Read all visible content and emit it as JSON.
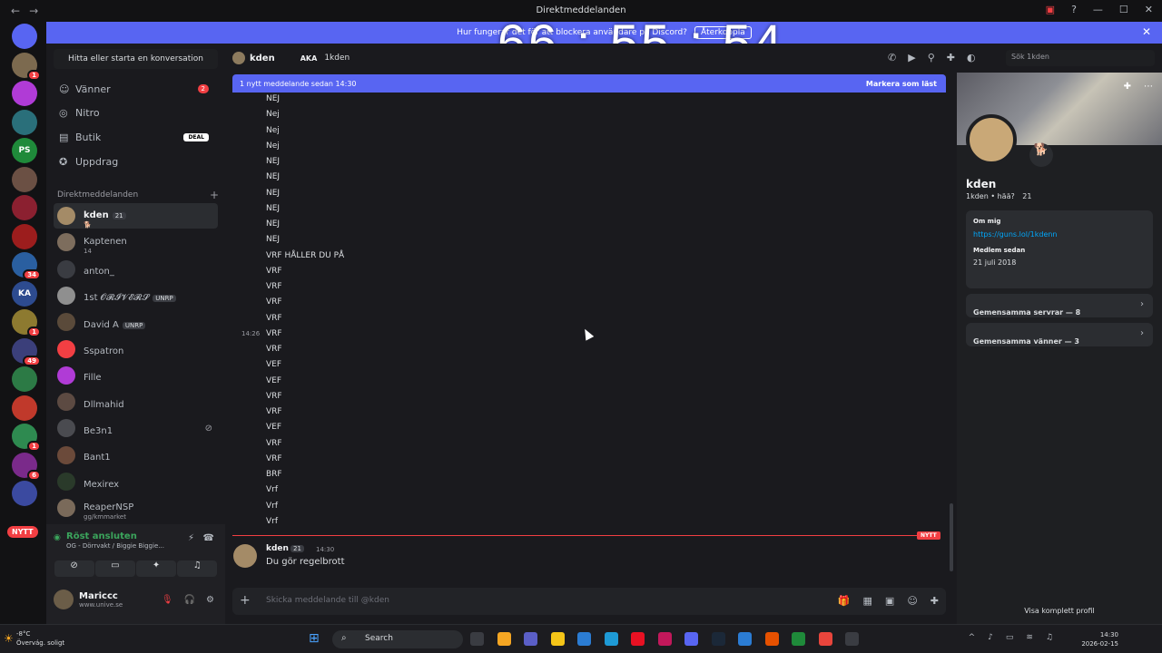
{
  "window": {
    "title": "Direktmeddelanden"
  },
  "timer": "66 : 55 : 54",
  "banner": {
    "text": "Hur fungerar det för att blockera användare på Discord?",
    "button": "Återkoppla"
  },
  "servers": {
    "items": [
      {
        "label": "",
        "color": "#5865f2",
        "badge": ""
      },
      {
        "label": "",
        "color": "#7c6a4f",
        "badge": "1"
      },
      {
        "label": "",
        "color": "#b03bd6",
        "badge": ""
      },
      {
        "label": "",
        "color": "#2a6f7a",
        "badge": ""
      },
      {
        "label": "PS",
        "color": "#1f8a3a",
        "badge": ""
      },
      {
        "label": "",
        "color": "#6b5044",
        "badge": ""
      },
      {
        "label": "",
        "color": "#8b2030",
        "badge": ""
      },
      {
        "label": "",
        "color": "#9c1d1d",
        "badge": ""
      },
      {
        "label": "",
        "color": "#2a5fa0",
        "badge": "34"
      },
      {
        "label": "KA",
        "color": "#2d4b8f",
        "badge": ""
      },
      {
        "label": "",
        "color": "#8d7a30",
        "badge": "1"
      },
      {
        "label": "",
        "color": "#3b3f7a",
        "badge": "49"
      },
      {
        "label": "",
        "color": "#2c7a45",
        "badge": ""
      },
      {
        "label": "",
        "color": "#c0392b",
        "badge": ""
      },
      {
        "label": "",
        "color": "#2e8a50",
        "badge": "1"
      },
      {
        "label": "",
        "color": "#7a2a8a",
        "badge": "6"
      },
      {
        "label": "",
        "color": "#3b4aa0",
        "badge": ""
      }
    ],
    "new_label": "NYTT"
  },
  "sidebar": {
    "search": "Hitta eller starta en konversation",
    "nav": [
      {
        "label": "Vänner",
        "icon": "friends-icon",
        "badge": "2"
      },
      {
        "label": "Nitro",
        "icon": "nitro-icon",
        "badge": ""
      },
      {
        "label": "Butik",
        "icon": "shop-icon",
        "badge": "DEAL"
      },
      {
        "label": "Uppdrag",
        "icon": "quest-icon",
        "badge": ""
      }
    ],
    "dm_header": "Direktmeddelanden",
    "dms": [
      {
        "name": "kden",
        "tag": "21",
        "sub": "🐕",
        "color": "#a48b67"
      },
      {
        "name": "Kaptenen",
        "tag": "",
        "sub": "14",
        "color": "#7d6d5d"
      },
      {
        "name": "anton_",
        "tag": "",
        "sub": "",
        "color": "#3a3c42"
      },
      {
        "name": "1st 𝓞𝓡𝓘𝓥𝓔𝓡𝓢",
        "tag": "UNRP",
        "sub": "",
        "color": "#8f8f8f"
      },
      {
        "name": "David A",
        "tag": "UNRP",
        "sub": "",
        "color": "#5a4a3a"
      },
      {
        "name": "Sspatron",
        "tag": "",
        "sub": "",
        "color": "#f23f43"
      },
      {
        "name": "Fille",
        "tag": "",
        "sub": "",
        "color": "#b03bd6"
      },
      {
        "name": "Dllmahid",
        "tag": "",
        "sub": "",
        "color": "#5c4a42"
      },
      {
        "name": "Be3n1",
        "tag": "",
        "sub": "",
        "color": "#4a4b50"
      },
      {
        "name": "Bant1",
        "tag": "",
        "sub": "",
        "color": "#6b4a3a"
      },
      {
        "name": "Mexirex",
        "tag": "",
        "sub": "",
        "color": "#2a3a2a"
      },
      {
        "name": "ReaperNSP",
        "tag": "",
        "sub": "gg/kmmarket",
        "color": "#7a6a5a"
      }
    ],
    "voice": {
      "status": "Röst ansluten",
      "channel": "OG - Dörrvakt / Biggie Biggie..."
    },
    "user": {
      "name": "Mariccc",
      "status": "www.unive.se"
    }
  },
  "chat": {
    "name": "kden",
    "aka": "AKA",
    "alias": "1kden",
    "search_placeholder": "Sök 1kden",
    "new_bar": "1 nytt meddelande sedan 14:30",
    "mark_read": "Markera som läst",
    "lines": [
      "NEJ",
      "Nej",
      "Nej",
      "Nej",
      "NEJ",
      "NEJ",
      "NEJ",
      "NEJ",
      "NEJ",
      "NEJ",
      "VRF HÅLLER DU PÅ",
      "VRF",
      "VRF",
      "VRF",
      "VRF",
      "VRF",
      "VRF",
      "VEF",
      "VEF",
      "VRF",
      "VRF",
      "VEF",
      "VRF",
      "VRF",
      "BRF",
      "Vrf",
      "Vrf",
      "Vrf"
    ],
    "line_timestamp": "14:26",
    "new_label": "NYTT",
    "last_message": {
      "author": "kden",
      "tag": "21",
      "time": "14:30",
      "text": "Du gör regelbrott"
    },
    "composer_placeholder": "Skicka meddelande till @kden"
  },
  "profile": {
    "name": "kden",
    "sub": "1kden • hää?",
    "tag": "21",
    "about_label": "Om mig",
    "link": "https://guns.lol/1kdenn",
    "member_label": "Medlem sedan",
    "member_since": "21 juli 2018",
    "mutual_servers": "Gemensamma servrar — 8",
    "mutual_friends": "Gemensamma vänner — 3",
    "full_profile": "Visa komplett profil"
  },
  "taskbar": {
    "temp": "-8°C",
    "weather": "Övervág. soligt",
    "search": "Search",
    "time": "14:30",
    "date": "2026-02-15"
  }
}
